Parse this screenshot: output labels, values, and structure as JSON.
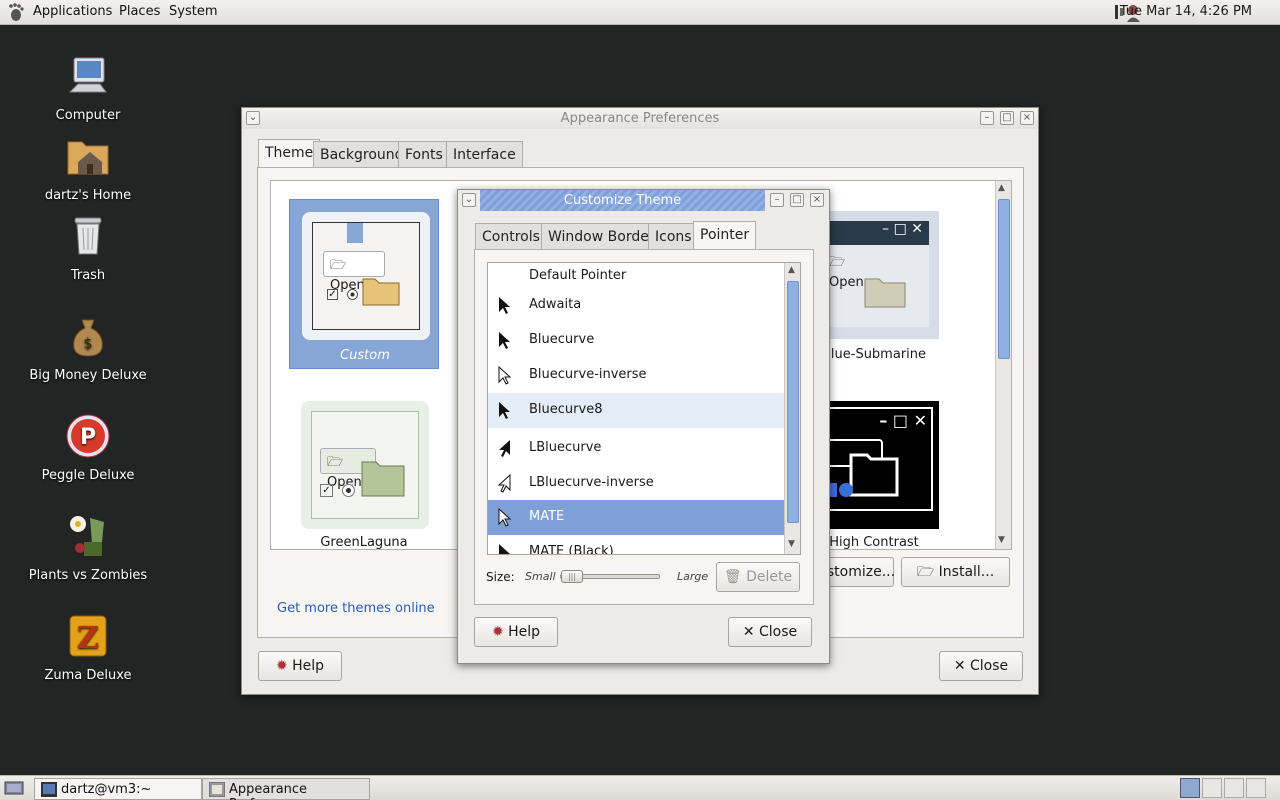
{
  "top_panel": {
    "menus": [
      "Applications",
      "Places",
      "System"
    ],
    "clock": "Tue Mar 14,  4:26 PM"
  },
  "desktop_icons": [
    {
      "label": "Computer"
    },
    {
      "label": "dartz's Home"
    },
    {
      "label": "Trash"
    },
    {
      "label": "Big Money Deluxe"
    },
    {
      "label": "Peggle Deluxe"
    },
    {
      "label": "Plants vs Zombies"
    },
    {
      "label": "Zuma Deluxe"
    }
  ],
  "taskbar": {
    "tasks": [
      "dartz@vm3:~",
      "Appearance Prefere..."
    ]
  },
  "appearance": {
    "title": "Appearance Preferences",
    "tabs": [
      "Theme",
      "Background",
      "Fonts",
      "Interface"
    ],
    "themes": [
      {
        "name": "Custom"
      },
      {
        "name": "GreenLaguna"
      },
      {
        "name": "Blue-Submarine"
      },
      {
        "name": "High Contrast"
      }
    ],
    "thumb_open": "Open",
    "get_more_link": "Get more themes online",
    "customize_button": "ustomize...",
    "install_button": "Install...",
    "help_button": "Help",
    "close_button": "Close"
  },
  "customize": {
    "title": "Customize Theme",
    "tabs": [
      "Controls",
      "Window Border",
      "Icons",
      "Pointer"
    ],
    "pointers": [
      "Default Pointer",
      "Adwaita",
      "Bluecurve",
      "Bluecurve-inverse",
      "Bluecurve8",
      "LBluecurve",
      "LBluecurve-inverse",
      "MATE",
      "MATE (Black)"
    ],
    "selected_pointer": "MATE",
    "size_label": "Size:",
    "size_small": "Small",
    "size_large": "Large",
    "delete_button": "Delete",
    "help_button": "Help",
    "close_button": "Close"
  }
}
